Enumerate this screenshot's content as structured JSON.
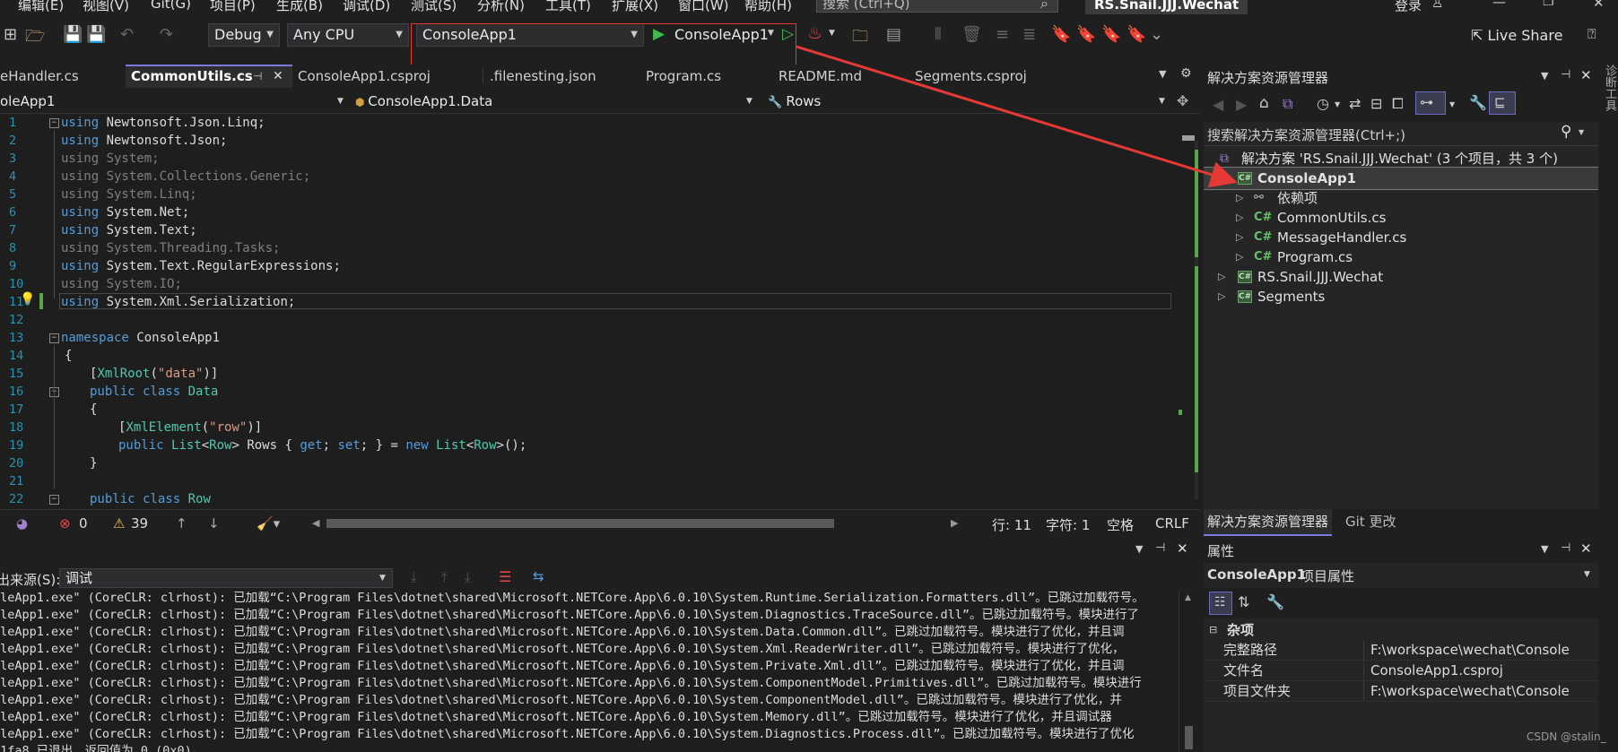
{
  "menu": {
    "items": [
      "编辑(E)",
      "视图(V)",
      "Git(G)",
      "项目(P)",
      "生成(B)",
      "调试(D)",
      "测试(S)",
      "分析(N)",
      "工具(T)",
      "扩展(X)",
      "窗口(W)",
      "帮助(H)"
    ],
    "search_placeholder": "搜索 (Ctrl+Q)",
    "solution_title": "RS.Snail.JJJ.Wechat",
    "login": "登录"
  },
  "toolbar": {
    "configuration": "Debug",
    "platform": "Any CPU",
    "startup_project": "ConsoleApp1",
    "run_label": "ConsoleApp1",
    "live_share": "Live Share"
  },
  "tabs": [
    {
      "label": "eHandler.cs",
      "active": false
    },
    {
      "label": "CommonUtils.cs",
      "active": true
    },
    {
      "label": "ConsoleApp1.csproj",
      "active": false
    },
    {
      "label": ".filenesting.json",
      "active": false
    },
    {
      "label": "Program.cs",
      "active": false
    },
    {
      "label": "README.md",
      "active": false
    },
    {
      "label": "Segments.csproj",
      "active": false
    }
  ],
  "navbar": {
    "project": "oleApp1",
    "type": "ConsoleApp1.Data",
    "member": "Rows"
  },
  "code": {
    "line_numbers": [
      "1",
      "2",
      "3",
      "4",
      "5",
      "6",
      "7",
      "8",
      "9",
      "10",
      "11",
      "12",
      "13",
      "14",
      "15",
      "16",
      "17",
      "18",
      "19",
      "20",
      "21",
      "22"
    ],
    "l1_kw": "using",
    "l1_rest": " Newtonsoft.Json.Linq;",
    "l2_kw": "using",
    "l2_rest": " Newtonsoft.Json;",
    "l3": "using System;",
    "l4": "using System.Collections.Generic;",
    "l5": "using System.Linq;",
    "l6_kw": "using",
    "l6_rest": " System.Net;",
    "l7_kw": "using",
    "l7_rest": " System.Text;",
    "l8": "using System.Threading.Tasks;",
    "l9_kw": "using",
    "l9_rest": " System.Text.RegularExpressions;",
    "l10": "using System.IO;",
    "l11_kw": "using",
    "l11_rest": " System.Xml.Serialization;",
    "l13_kw": "namespace",
    "l13_rest": " ConsoleApp1",
    "l14": "{",
    "l15_open": "[",
    "l15_attr": "XmlRoot",
    "l15_p1": "(",
    "l15_str": "\"data\"",
    "l15_close": ")]",
    "l16_kw": "public class",
    "l16_type": "Data",
    "l17": "{",
    "l18_open": "[",
    "l18_attr": "XmlElement",
    "l18_p1": "(",
    "l18_str": "\"row\"",
    "l18_close": ")]",
    "l19_kw1": "public",
    "l19_type1": "List",
    "l19_a": "<",
    "l19_type2": "Row",
    "l19_b": "> Rows { ",
    "l19_kw2": "get",
    "l19_c": "; ",
    "l19_kw3": "set",
    "l19_d": "; } = ",
    "l19_kw4": "new",
    "l19_e": " ",
    "l19_type3": "List",
    "l19_f": "<",
    "l19_type4": "Row",
    "l19_g": ">();",
    "l20": "}",
    "l22_kw": "public class",
    "l22_type": "Row"
  },
  "editor_status": {
    "errors": "0",
    "warnings": "39",
    "line": "行: 11",
    "col": "字符: 1",
    "whitespace": "空格",
    "eol": "CRLF"
  },
  "output": {
    "source_label": "出来源(S):",
    "source_value": "调试",
    "lines": [
      "oleApp1.exe\" (CoreCLR: clrhost): 已加载“C:\\Program Files\\dotnet\\shared\\Microsoft.NETCore.App\\6.0.10\\System.Runtime.Serialization.Formatters.dll”。已跳过加载符号。",
      "oleApp1.exe\" (CoreCLR: clrhost): 已加载“C:\\Program Files\\dotnet\\shared\\Microsoft.NETCore.App\\6.0.10\\System.Diagnostics.TraceSource.dll”。已跳过加载符号。模块进行了",
      "oleApp1.exe\" (CoreCLR: clrhost): 已加载“C:\\Program Files\\dotnet\\shared\\Microsoft.NETCore.App\\6.0.10\\System.Data.Common.dll”。已跳过加载符号。模块进行了优化，并且调",
      "oleApp1.exe\" (CoreCLR: clrhost): 已加载“C:\\Program Files\\dotnet\\shared\\Microsoft.NETCore.App\\6.0.10\\System.Xml.ReaderWriter.dll”。已跳过加载符号。模块进行了优化，",
      "oleApp1.exe\" (CoreCLR: clrhost): 已加载“C:\\Program Files\\dotnet\\shared\\Microsoft.NETCore.App\\6.0.10\\System.Private.Xml.dll”。已跳过加载符号。模块进行了优化，并且调",
      "oleApp1.exe\" (CoreCLR: clrhost): 已加载“C:\\Program Files\\dotnet\\shared\\Microsoft.NETCore.App\\6.0.10\\System.ComponentModel.Primitives.dll”。已跳过加载符号。模块进行",
      "oleApp1.exe\" (CoreCLR: clrhost): 已加载“C:\\Program Files\\dotnet\\shared\\Microsoft.NETCore.App\\6.0.10\\System.ComponentModel.dll”。已跳过加载符号。模块进行了优化，并",
      "oleApp1.exe\" (CoreCLR: clrhost): 已加载“C:\\Program Files\\dotnet\\shared\\Microsoft.NETCore.App\\6.0.10\\System.Memory.dll”。已跳过加载符号。模块进行了优化，并且调试器",
      "oleApp1.exe\" (CoreCLR: clrhost): 已加载“C:\\Program Files\\dotnet\\shared\\Microsoft.NETCore.App\\6.0.10\\System.Diagnostics.Process.dll”。已跳过加载符号。模块进行了优化",
      "x1fa8 已退出，返回值为 0 (0x0)。"
    ]
  },
  "solution_explorer": {
    "title": "解决方案资源管理器",
    "search_placeholder": "搜索解决方案资源管理器(Ctrl+;)",
    "solution_label": "解决方案 'RS.Snail.JJJ.Wechat' (3 个项目，共 3 个)",
    "items": [
      {
        "label": "ConsoleApp1"
      },
      {
        "label": "依赖项"
      },
      {
        "label": "CommonUtils.cs"
      },
      {
        "label": "MessageHandler.cs"
      },
      {
        "label": "Program.cs"
      },
      {
        "label": "RS.Snail.JJJ.Wechat"
      },
      {
        "label": "Segments"
      }
    ],
    "bottom_tabs": [
      "解决方案资源管理器",
      "Git 更改"
    ]
  },
  "properties": {
    "title": "属性",
    "object": "ConsoleApp1",
    "object_type": "项目属性",
    "category": "杂项",
    "rows": [
      {
        "name": "完整路径",
        "value": "F:\\workspace\\wechat\\Console"
      },
      {
        "name": "文件名",
        "value": "ConsoleApp1.csproj"
      },
      {
        "name": "项目文件夹",
        "value": "F:\\workspace\\wechat\\Console"
      }
    ]
  },
  "side_label": "诊断工具",
  "watermark": "CSDN @stalin_",
  "colors": {
    "highlight_red": "#e53935",
    "keyword_blue": "#569cd6",
    "type_teal": "#4ec9b0",
    "string_brown": "#d69d85",
    "line_number": "#2b91af"
  }
}
